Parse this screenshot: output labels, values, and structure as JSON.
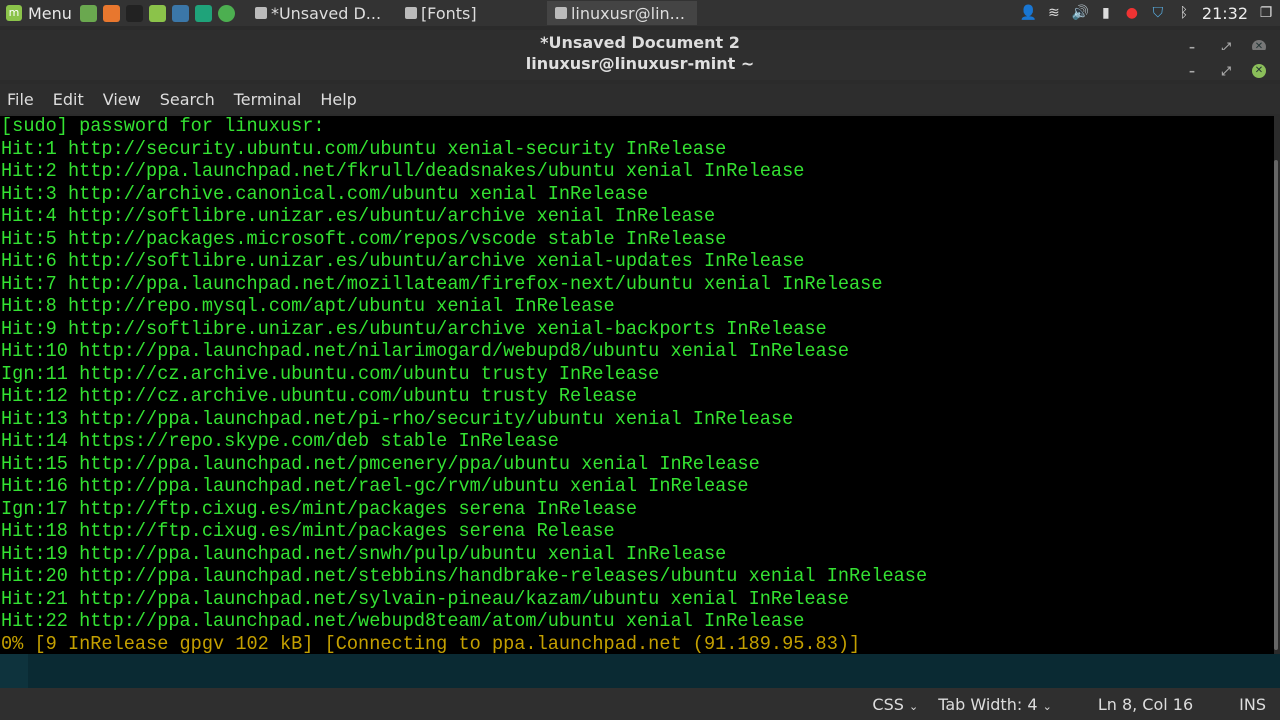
{
  "panel": {
    "menu_label": "Menu",
    "launchers": [
      {
        "icon": "show-desktop-icon",
        "color": "#6aa84f"
      },
      {
        "icon": "firefox-icon",
        "color": "#e8772e"
      },
      {
        "icon": "terminal-icon",
        "color": "#222222"
      },
      {
        "icon": "files-icon",
        "color": "#8bc34a"
      },
      {
        "icon": "python-icon",
        "color": "#3b77a8"
      },
      {
        "icon": "clion-icon",
        "color": "#1fa37a"
      },
      {
        "icon": "app-icon",
        "color": "#4caf50"
      }
    ],
    "tasks": [
      {
        "label": "*Unsaved D...",
        "icon": "text-editor-icon"
      },
      {
        "label": "[Fonts]",
        "icon": "fonts-icon"
      },
      {
        "label": "linuxusr@lin...",
        "icon": "terminal-icon",
        "active": true
      }
    ],
    "clock": "21:32"
  },
  "background_window": {
    "title": "*Unsaved Document 2"
  },
  "terminal": {
    "title": "linuxusr@linuxusr-mint ~",
    "menu": [
      "File",
      "Edit",
      "View",
      "Search",
      "Terminal",
      "Help"
    ],
    "lines": [
      "[sudo] password for linuxusr:",
      "Hit:1 http://security.ubuntu.com/ubuntu xenial-security InRelease",
      "Hit:2 http://ppa.launchpad.net/fkrull/deadsnakes/ubuntu xenial InRelease",
      "Hit:3 http://archive.canonical.com/ubuntu xenial InRelease",
      "Hit:4 http://softlibre.unizar.es/ubuntu/archive xenial InRelease",
      "Hit:5 http://packages.microsoft.com/repos/vscode stable InRelease",
      "Hit:6 http://softlibre.unizar.es/ubuntu/archive xenial-updates InRelease",
      "Hit:7 http://ppa.launchpad.net/mozillateam/firefox-next/ubuntu xenial InRelease",
      "Hit:8 http://repo.mysql.com/apt/ubuntu xenial InRelease",
      "Hit:9 http://softlibre.unizar.es/ubuntu/archive xenial-backports InRelease",
      "Hit:10 http://ppa.launchpad.net/nilarimogard/webupd8/ubuntu xenial InRelease",
      "Ign:11 http://cz.archive.ubuntu.com/ubuntu trusty InRelease",
      "Hit:12 http://cz.archive.ubuntu.com/ubuntu trusty Release",
      "Hit:13 http://ppa.launchpad.net/pi-rho/security/ubuntu xenial InRelease",
      "Hit:14 https://repo.skype.com/deb stable InRelease",
      "Hit:15 http://ppa.launchpad.net/pmcenery/ppa/ubuntu xenial InRelease",
      "Hit:16 http://ppa.launchpad.net/rael-gc/rvm/ubuntu xenial InRelease",
      "Ign:17 http://ftp.cixug.es/mint/packages serena InRelease",
      "Hit:18 http://ftp.cixug.es/mint/packages serena Release",
      "Hit:19 http://ppa.launchpad.net/snwh/pulp/ubuntu xenial InRelease",
      "Hit:20 http://ppa.launchpad.net/stebbins/handbrake-releases/ubuntu xenial InRelease",
      "Hit:21 http://ppa.launchpad.net/sylvain-pineau/kazam/ubuntu xenial InRelease",
      "Hit:22 http://ppa.launchpad.net/webupd8team/atom/ubuntu xenial InRelease"
    ],
    "progress_line": "0% [9 InRelease gpgv 102 kB] [Connecting to ppa.launchpad.net (91.189.95.83)]",
    "text_color": "#34e232",
    "progress_color": "#c4a000"
  },
  "statusbar": {
    "language": "CSS",
    "tab_width": "Tab Width: 4",
    "position": "Ln 8, Col 16",
    "mode": "INS"
  }
}
